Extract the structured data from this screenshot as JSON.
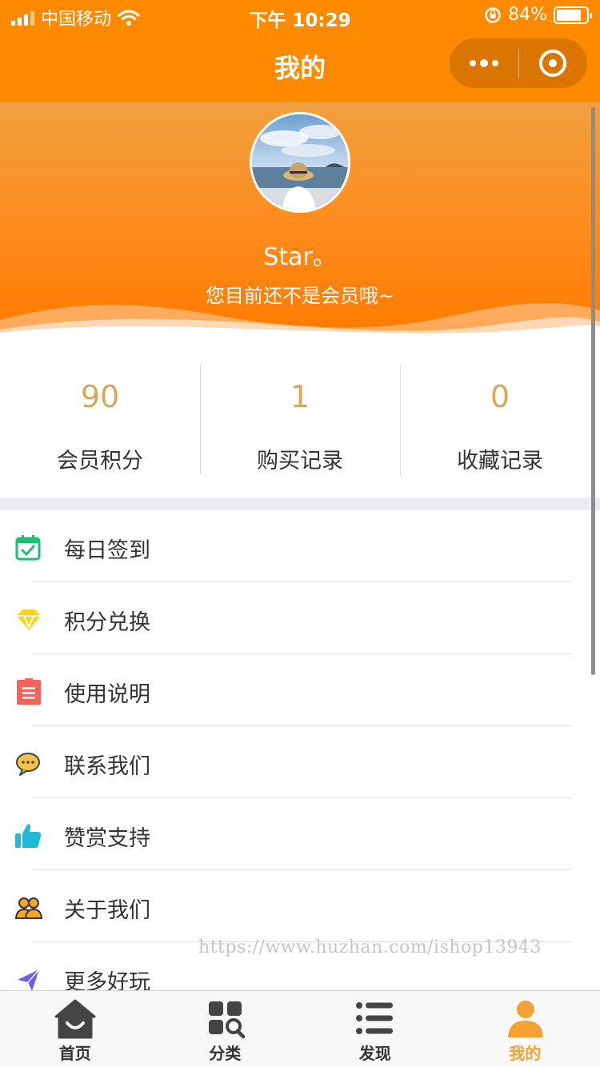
{
  "status_bar": {
    "carrier": "中国移动",
    "time": "下午 10:29",
    "battery": "84%",
    "battery_level": 0.84
  },
  "nav": {
    "title": "我的"
  },
  "profile": {
    "name": "Star。",
    "subtitle": "您目前还不是会员哦~"
  },
  "stats": [
    {
      "value": "90",
      "label": "会员积分"
    },
    {
      "value": "1",
      "label": "购买记录"
    },
    {
      "value": "0",
      "label": "收藏记录"
    }
  ],
  "menu": [
    {
      "label": "每日签到",
      "icon": "calendar-check-icon",
      "color": "#1dbf73"
    },
    {
      "label": "积分兑换",
      "icon": "diamond-icon",
      "color": "#ffd21f"
    },
    {
      "label": "使用说明",
      "icon": "clipboard-icon",
      "color": "#f0645a"
    },
    {
      "label": "联系我们",
      "icon": "chat-icon",
      "color": "#f5c242"
    },
    {
      "label": "赞赏支持",
      "icon": "thumbs-up-icon",
      "color": "#1fb9d6"
    },
    {
      "label": "关于我们",
      "icon": "users-icon",
      "color": "#f5a623"
    },
    {
      "label": "更多好玩",
      "icon": "send-icon",
      "color": "#6a5cf5"
    }
  ],
  "watermark": "https://www.huzhan.com/ishop13943",
  "tabs": [
    {
      "label": "首页",
      "icon": "home-icon"
    },
    {
      "label": "分类",
      "icon": "category-icon"
    },
    {
      "label": "发现",
      "icon": "list-icon"
    },
    {
      "label": "我的",
      "icon": "user-icon",
      "active": true
    }
  ],
  "colors": {
    "primary": "#ff8a00",
    "stat_value": "#d6a85a",
    "tab_active": "#f5a033",
    "tab_inactive": "#444444"
  }
}
